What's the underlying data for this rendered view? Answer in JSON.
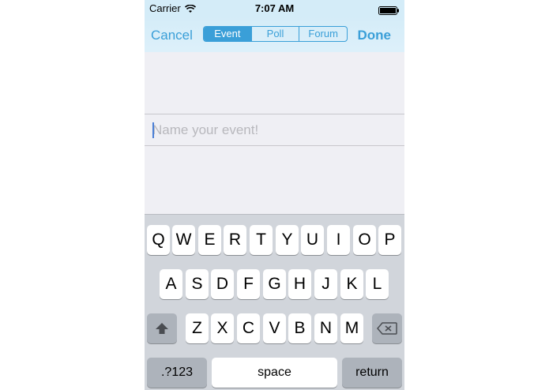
{
  "status_bar": {
    "carrier": "Carrier",
    "time": "7:07 AM"
  },
  "nav": {
    "cancel": "Cancel",
    "done": "Done",
    "segments": [
      "Event",
      "Poll",
      "Forum"
    ],
    "selected_segment": "Event"
  },
  "form": {
    "name_placeholder": "Name your event!",
    "name_value": ""
  },
  "keyboard": {
    "row1": [
      "Q",
      "W",
      "E",
      "R",
      "T",
      "Y",
      "U",
      "I",
      "O",
      "P"
    ],
    "row2": [
      "A",
      "S",
      "D",
      "F",
      "G",
      "H",
      "J",
      "K",
      "L"
    ],
    "row3": [
      "Z",
      "X",
      "C",
      "V",
      "B",
      "N",
      "M"
    ],
    "numbers_key": ".?123",
    "space_key": "space",
    "return_key": "return"
  },
  "colors": {
    "accent": "#3a9fd8",
    "background": "#efeff4",
    "keyboard": "#d1d5db"
  },
  "icons": {
    "wifi": "wifi-icon",
    "battery": "battery-icon",
    "shift": "shift-icon",
    "delete": "delete-icon"
  }
}
